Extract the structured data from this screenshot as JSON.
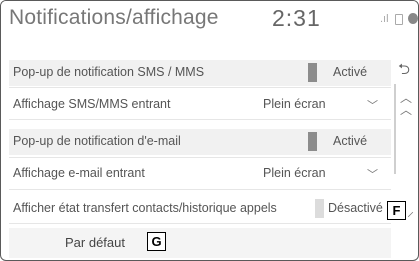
{
  "header": {
    "title": "Notifications/affichage",
    "time": "2:31",
    "icons": [
      "signal-icon",
      "sim-icon",
      "phone-icon"
    ]
  },
  "settings": [
    {
      "label": "Pop-up de notification SMS / MMS",
      "type": "toggle",
      "value": "Activé"
    },
    {
      "label": "Affichage SMS/MMS entrant",
      "type": "select",
      "value": "Plein écran"
    },
    {
      "label": "Pop-up de notification d'e-mail",
      "type": "toggle",
      "value": "Activé"
    },
    {
      "label": "Affichage e-mail entrant",
      "type": "select",
      "value": "Plein écran"
    },
    {
      "label": "Afficher état transfert contacts/historique appels",
      "type": "toggle",
      "value": "Désactivé"
    }
  ],
  "default_button": {
    "label": "Par défaut"
  },
  "callouts": {
    "f": "F",
    "g": "G"
  },
  "colors": {
    "toggle_bar": "#8c8c8c",
    "row_shade": "#f1f1f1"
  }
}
